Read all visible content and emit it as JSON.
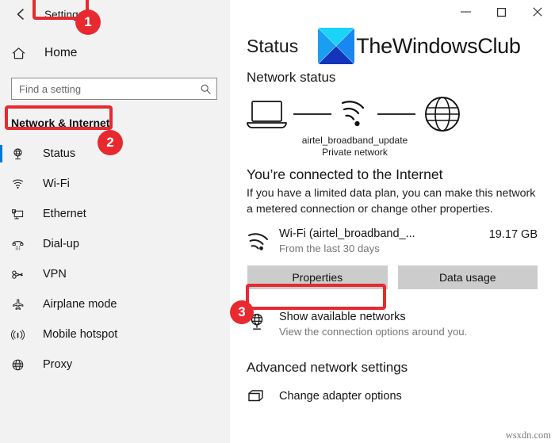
{
  "window": {
    "app_title": "Settings",
    "back_icon": "back-arrow-icon",
    "controls": {
      "minimize": "—",
      "maximize": "□",
      "close": "✕"
    }
  },
  "sidebar": {
    "home": {
      "label": "Home",
      "icon": "home-icon"
    },
    "search": {
      "placeholder": "Find a setting",
      "value": "",
      "icon": "search-icon"
    },
    "category": "Network & Internet",
    "items": [
      {
        "label": "Status",
        "icon": "globe-monitor-icon",
        "selected": true
      },
      {
        "label": "Wi-Fi",
        "icon": "wifi-icon",
        "selected": false
      },
      {
        "label": "Ethernet",
        "icon": "ethernet-icon",
        "selected": false
      },
      {
        "label": "Dial-up",
        "icon": "dialup-phone-icon",
        "selected": false
      },
      {
        "label": "VPN",
        "icon": "vpn-key-icon",
        "selected": false
      },
      {
        "label": "Airplane mode",
        "icon": "airplane-icon",
        "selected": false
      },
      {
        "label": "Mobile hotspot",
        "icon": "hotspot-broadcast-icon",
        "selected": false
      },
      {
        "label": "Proxy",
        "icon": "globe-icon",
        "selected": false
      }
    ]
  },
  "main": {
    "page_title": "Status",
    "logo_text": "TheWindowsClub",
    "section_heading": "Network status",
    "diagram": {
      "device_icon": "laptop-icon",
      "signal_icon": "wifi-signal-icon",
      "internet_icon": "globe-icon",
      "ssid": "airtel_broadband_update",
      "network_type": "Private network"
    },
    "connected_title": "You’re connected to the Internet",
    "connected_desc": "If you have a limited data plan, you can make this network a metered connection or change other properties.",
    "usage": {
      "icon": "wifi-signal-icon",
      "name": "Wi-Fi (airtel_broadband_...",
      "subtitle": "From the last 30 days",
      "amount": "19.17 GB"
    },
    "buttons": {
      "properties": "Properties",
      "data_usage": "Data usage"
    },
    "show_networks": {
      "icon": "globe-monitor-icon",
      "title": "Show available networks",
      "subtitle": "View the connection options around you."
    },
    "advanced_heading": "Advanced network settings",
    "adapter_options": {
      "icon": "adapter-icon",
      "label": "Change adapter options"
    },
    "watermark": "wsxdn.com"
  },
  "annotations": {
    "accent_color": "#e8292f",
    "badges": [
      {
        "number": "1"
      },
      {
        "number": "2"
      },
      {
        "number": "3"
      }
    ]
  },
  "colors": {
    "sidebar_bg": "#f2f2f2",
    "content_bg": "#ffffff",
    "selection_blue": "#0078d7",
    "button_bg": "#cccccc",
    "annotation_red": "#e8292f",
    "logo_cyan": "#19d5f5",
    "logo_blue": "#0f6fe0",
    "logo_dark_blue": "#1433b8"
  }
}
